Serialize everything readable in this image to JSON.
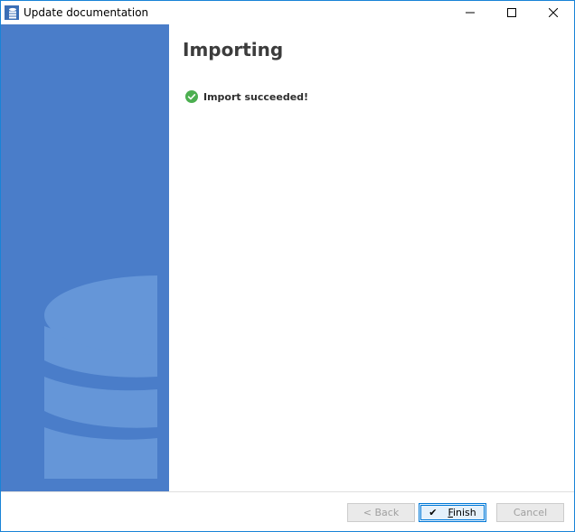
{
  "window": {
    "title": "Update documentation",
    "minimize_icon": "minimize-icon",
    "maximize_icon": "maximize-icon",
    "close_icon": "close-icon"
  },
  "main": {
    "title": "Importing",
    "status": {
      "icon": "check-circle-icon",
      "text": "Import succeeded!",
      "color": "#4caf50"
    }
  },
  "sidebar": {
    "icon": "database-icon",
    "background": "#4a7dc9",
    "shape_color": "#6596d8"
  },
  "footer": {
    "back_label": "< Back",
    "finish_label": "Finish",
    "cancel_label": "Cancel",
    "finish_icon": "checkmark-icon"
  }
}
